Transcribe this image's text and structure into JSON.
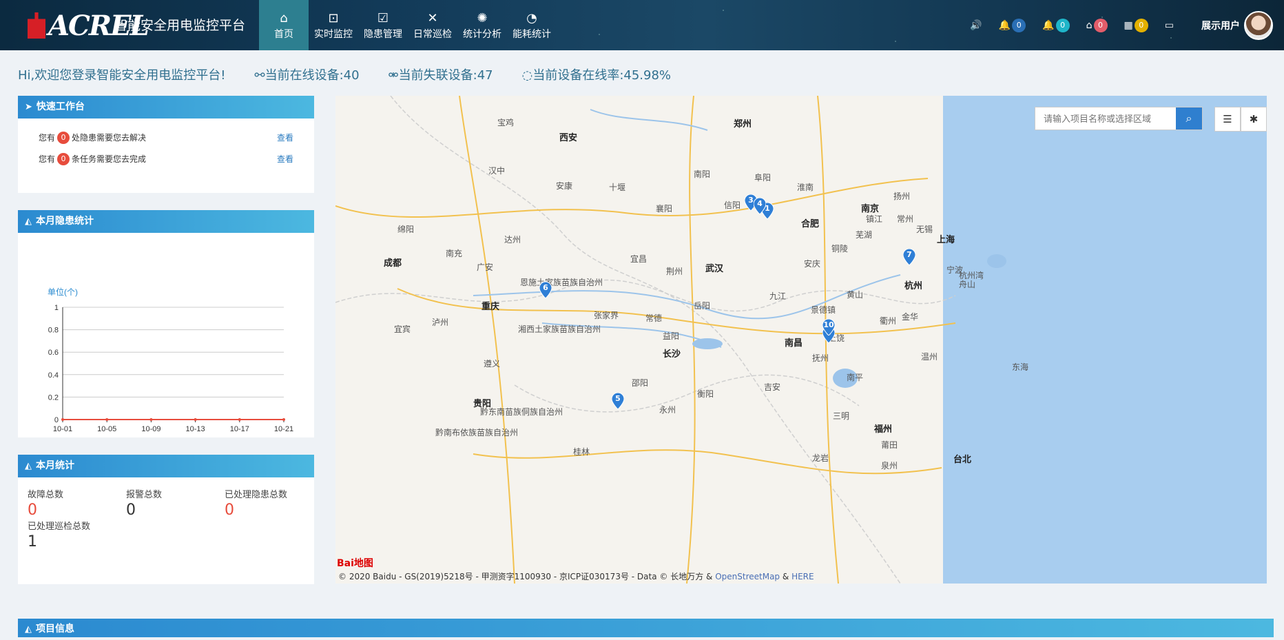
{
  "header": {
    "logo_text": "ACREL",
    "app_title": "智能安全用电监控平台",
    "nav": [
      {
        "label": "首页",
        "icon": "home-icon",
        "glyph": "⌂",
        "active": true
      },
      {
        "label": "实时监控",
        "icon": "monitor-search-icon",
        "glyph": "⊡"
      },
      {
        "label": "隐患管理",
        "icon": "clipboard-check-icon",
        "glyph": "☑"
      },
      {
        "label": "日常巡检",
        "icon": "tools-icon",
        "glyph": "✕"
      },
      {
        "label": "统计分析",
        "icon": "fan-icon",
        "glyph": "✺"
      },
      {
        "label": "能耗统计",
        "icon": "pie-icon",
        "glyph": "◔"
      }
    ],
    "tools": [
      {
        "icon": "speaker-icon",
        "glyph": "🔊",
        "badge": null
      },
      {
        "icon": "bell-icon",
        "glyph": "🔔",
        "badge": "0",
        "color": "#2a6fb5"
      },
      {
        "icon": "bell-alt-icon",
        "glyph": "🔔",
        "badge": "0",
        "color": "#1fb5c9"
      },
      {
        "icon": "home-alert-icon",
        "glyph": "⌂",
        "badge": "0",
        "color": "#e35d6a"
      },
      {
        "icon": "grid-icon",
        "glyph": "▦",
        "badge": "0",
        "color": "#e3b000"
      },
      {
        "icon": "desktop-icon",
        "glyph": "▭",
        "badge": null
      }
    ],
    "user_name": "展示用户"
  },
  "welcome": {
    "greeting": "Hi,欢迎您登录智能安全用电监控平台!",
    "online": "当前在线设备:40",
    "offline": "当前失联设备:47",
    "rate": "当前设备在线率:45.98%"
  },
  "workbench": {
    "title": "快速工作台",
    "items": [
      {
        "prefix": "您有",
        "count": "0",
        "suffix": "处隐患需要您去解决",
        "link": "查看"
      },
      {
        "prefix": "您有",
        "count": "0",
        "suffix": "条任务需要您去完成",
        "link": "查看"
      }
    ]
  },
  "hazard_stats": {
    "title": "本月隐患统计"
  },
  "chart_data": {
    "type": "line",
    "title": "",
    "ylabel": "单位(个)",
    "xlabel": "",
    "x": [
      "10-01",
      "10-02",
      "10-03",
      "10-04",
      "10-05",
      "10-06",
      "10-07",
      "10-08",
      "10-09",
      "10-10",
      "10-11",
      "10-12",
      "10-13",
      "10-14",
      "10-15",
      "10-16",
      "10-17",
      "10-18",
      "10-19",
      "10-20",
      "10-21"
    ],
    "xticks": [
      "10-01",
      "10-05",
      "10-09",
      "10-13",
      "10-17",
      "10-21"
    ],
    "series": [
      {
        "values": [
          0,
          0,
          0,
          0,
          0,
          0,
          0,
          0,
          0,
          0,
          0,
          0,
          0,
          0,
          0,
          0,
          0,
          0,
          0,
          0,
          0
        ],
        "color": "#e74c3c"
      }
    ],
    "ylim": [
      0,
      1
    ],
    "yticks": [
      "0",
      "0.2",
      "0.4",
      "0.6",
      "0.8",
      "1"
    ],
    "grid": true
  },
  "month_stats": {
    "title": "本月统计",
    "items": [
      {
        "label": "故障总数",
        "value": "0",
        "style": "red"
      },
      {
        "label": "报警总数",
        "value": "0",
        "style": "dark"
      },
      {
        "label": "已处理隐患总数",
        "value": "0",
        "style": "red"
      },
      {
        "label": "已处理巡检总数",
        "value": "1",
        "style": "dark"
      }
    ]
  },
  "map": {
    "search_placeholder": "请输入项目名称或选择区域",
    "cities": [
      {
        "name": "郑州",
        "big": true
      },
      {
        "name": "西安",
        "big": true
      },
      {
        "name": "成都",
        "big": true
      },
      {
        "name": "重庆",
        "big": true
      },
      {
        "name": "武汉",
        "big": true
      },
      {
        "name": "合肥",
        "big": true
      },
      {
        "name": "南京",
        "big": true
      },
      {
        "name": "上海",
        "big": true
      },
      {
        "name": "杭州",
        "big": true
      },
      {
        "name": "长沙",
        "big": true
      },
      {
        "name": "南昌",
        "big": true
      },
      {
        "name": "贵阳",
        "big": true
      },
      {
        "name": "福州",
        "big": true
      },
      {
        "name": "台北",
        "big": true
      },
      {
        "name": "宝鸡"
      },
      {
        "name": "汉中"
      },
      {
        "name": "安康"
      },
      {
        "name": "十堰"
      },
      {
        "name": "襄阳"
      },
      {
        "name": "南阳"
      },
      {
        "name": "信阳"
      },
      {
        "name": "阜阳"
      },
      {
        "name": "淮南"
      },
      {
        "name": "扬州"
      },
      {
        "name": "镇江"
      },
      {
        "name": "常州"
      },
      {
        "name": "无锡"
      },
      {
        "name": "芜湖"
      },
      {
        "name": "宜昌"
      },
      {
        "name": "荆州"
      },
      {
        "name": "岳阳"
      },
      {
        "name": "常德"
      },
      {
        "name": "益阳"
      },
      {
        "name": "衡阳"
      },
      {
        "name": "九江"
      },
      {
        "name": "景德镇"
      },
      {
        "name": "上饶"
      },
      {
        "name": "衢州"
      },
      {
        "name": "金华"
      },
      {
        "name": "温州"
      },
      {
        "name": "宁波"
      },
      {
        "name": "张家界"
      },
      {
        "name": "遵义"
      },
      {
        "name": "南充"
      },
      {
        "name": "达州"
      },
      {
        "name": "广安"
      },
      {
        "name": "绵阳"
      },
      {
        "name": "泸州"
      },
      {
        "name": "宜宾"
      },
      {
        "name": "邵阳"
      },
      {
        "name": "永州"
      },
      {
        "name": "桂林"
      },
      {
        "name": "吉安"
      },
      {
        "name": "抚州"
      },
      {
        "name": "南平"
      },
      {
        "name": "三明"
      },
      {
        "name": "莆田"
      },
      {
        "name": "泉州"
      },
      {
        "name": "龙岩"
      },
      {
        "name": "安庆"
      },
      {
        "name": "铜陵"
      },
      {
        "name": "黄山"
      },
      {
        "name": "东海"
      },
      {
        "name": "杭州湾"
      },
      {
        "name": "舟山"
      },
      {
        "name": "湘西土家族苗族自治州"
      },
      {
        "name": "恩施土家族苗族自治州"
      },
      {
        "name": "黔东南苗族侗族自治州"
      },
      {
        "name": "黔南布依族苗族自治州"
      }
    ],
    "markers": [
      "1",
      "3",
      "4",
      "5",
      "6",
      "7",
      "8",
      "10"
    ],
    "baidu_logo": "Bai地图",
    "copyright": "© 2020 Baidu - GS(2019)5218号 - 甲测资字1100930 - 京ICP证030173号 - Data © 长地万方 &",
    "copyright_osm": "OpenStreetMap",
    "copyright_amp": "&",
    "copyright_here": "HERE"
  },
  "project_info": {
    "title": "项目信息"
  }
}
